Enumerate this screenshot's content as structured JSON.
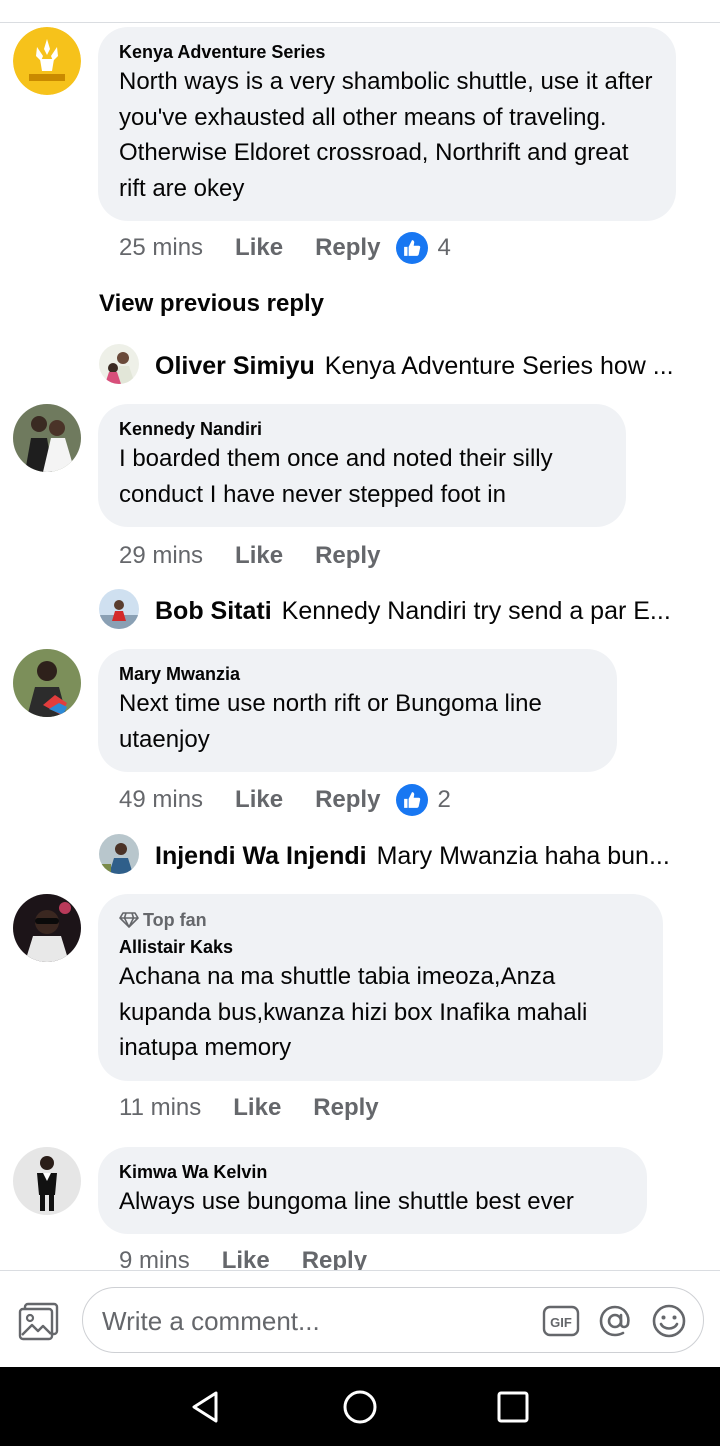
{
  "comments": [
    {
      "name": "Kenya Adventure Series",
      "text": "North ways is a very shambolic shuttle, use it after you've exhausted all other means of traveling. Otherwise Eldoret crossroad, Northrift and great rift are okey",
      "time": "25 mins",
      "like_label": "Like",
      "reply_label": "Reply",
      "reaction_count": "4"
    },
    {
      "name": "Kennedy Nandiri",
      "text": "I boarded them once and noted their silly conduct I have never stepped foot in",
      "time": "29 mins",
      "like_label": "Like",
      "reply_label": "Reply"
    },
    {
      "name": "Mary Mwanzia",
      "text": "Next time use north rift or Bungoma line utaenjoy",
      "time": "49 mins",
      "like_label": "Like",
      "reply_label": "Reply",
      "reaction_count": "2"
    },
    {
      "badge": "Top fan",
      "name": "Allistair Kaks",
      "text": "Achana na ma shuttle tabia imeoza,Anza kupanda bus,kwanza hizi box Inafika mahali inatupa memory",
      "time": "11 mins",
      "like_label": "Like",
      "reply_label": "Reply"
    },
    {
      "name": "Kimwa Wa Kelvin",
      "text": "Always use bungoma line shuttle best ever",
      "time": "9 mins",
      "like_label": "Like",
      "reply_label": "Reply"
    }
  ],
  "view_previous_reply": "View previous reply",
  "replies": [
    {
      "name": "Oliver Simiyu",
      "text": "Kenya Adventure Series how ..."
    },
    {
      "name": "Bob Sitati",
      "text": "Kennedy Nandiri try send a par E..."
    },
    {
      "name": "Injendi Wa Injendi",
      "text": "Mary Mwanzia haha bun..."
    }
  ],
  "composer": {
    "placeholder": "Write a comment..."
  },
  "colors": {
    "accent": "#1877f2",
    "bubble": "#f0f2f5",
    "muted": "#65676b"
  }
}
